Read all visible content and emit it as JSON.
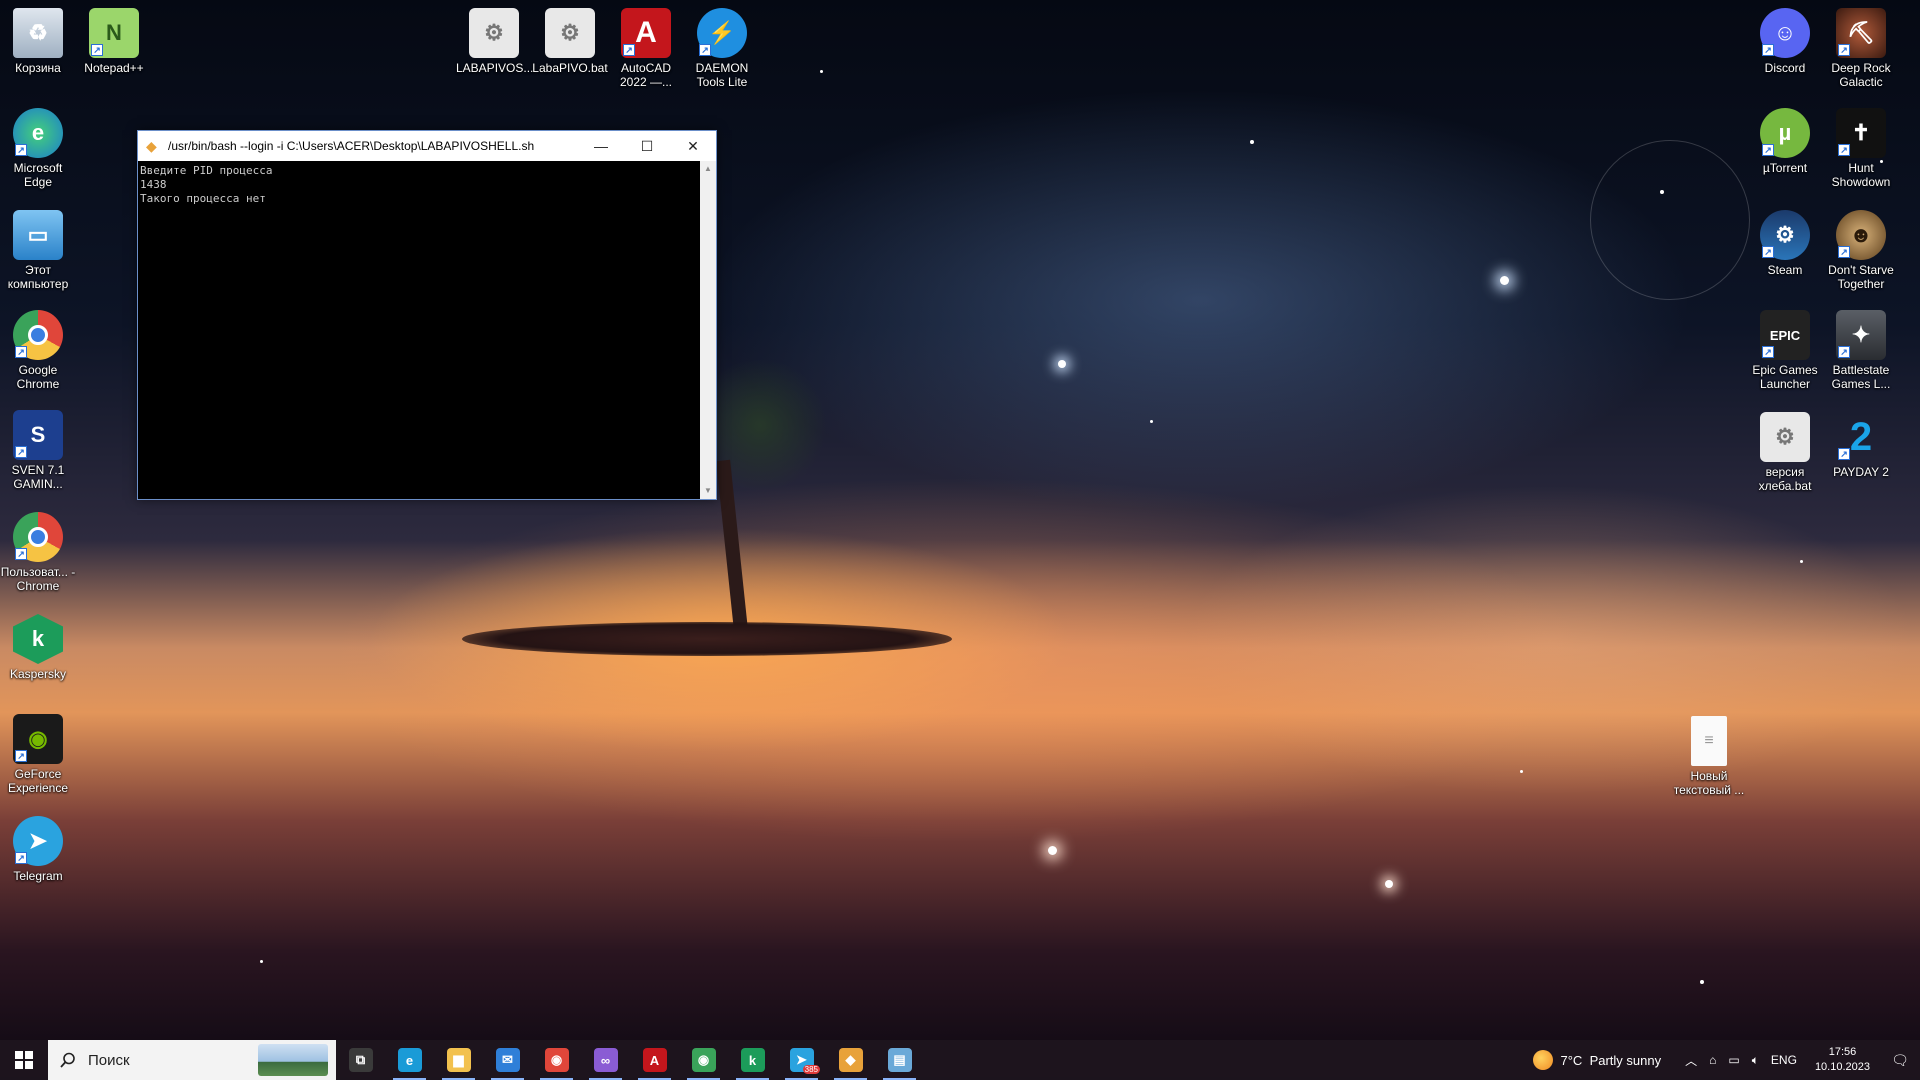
{
  "desktop": {
    "icons_left": [
      {
        "label": "Корзина",
        "icon": "recycle-bin-icon"
      },
      {
        "label": "Notepad++",
        "icon": "notepadpp-icon"
      },
      {
        "label": "Microsoft Edge",
        "icon": "edge-icon"
      },
      {
        "label": "Этот компьютер",
        "icon": "this-pc-icon"
      },
      {
        "label": "Google Chrome",
        "icon": "chrome-icon"
      },
      {
        "label": "SVEN 7.1 GAMIN...",
        "icon": "sven-icon"
      },
      {
        "label": "Пользоват... - Chrome",
        "icon": "chrome-user-icon"
      },
      {
        "label": "Kaspersky",
        "icon": "kaspersky-icon"
      },
      {
        "label": "GeForce Experience",
        "icon": "geforce-icon"
      },
      {
        "label": "Telegram",
        "icon": "telegram-icon"
      }
    ],
    "icons_top": [
      {
        "label": "LABAPIVOS...",
        "icon": "batch-file-icon"
      },
      {
        "label": "LabaPIVO.bat",
        "icon": "batch-file-icon"
      },
      {
        "label": "AutoCAD 2022 —...",
        "icon": "autocad-icon"
      },
      {
        "label": "DAEMON Tools Lite",
        "icon": "daemon-tools-icon"
      }
    ],
    "icons_right": [
      {
        "label": "Discord",
        "icon": "discord-icon"
      },
      {
        "label": "Deep Rock Galactic",
        "icon": "deep-rock-icon"
      },
      {
        "label": "µTorrent",
        "icon": "utorrent-icon"
      },
      {
        "label": "Hunt Showdown",
        "icon": "hunt-icon"
      },
      {
        "label": "Steam",
        "icon": "steam-icon"
      },
      {
        "label": "Don't Starve Together",
        "icon": "dont-starve-icon"
      },
      {
        "label": "Epic Games Launcher",
        "icon": "epic-games-icon"
      },
      {
        "label": "Battlestate Games L...",
        "icon": "battlestate-icon"
      },
      {
        "label": "версия хлеба.bat",
        "icon": "batch-file-icon"
      },
      {
        "label": "PAYDAY 2",
        "icon": "payday-icon"
      },
      {
        "label": "Новый текстовый ...",
        "icon": "text-file-icon"
      }
    ]
  },
  "terminal": {
    "title": "/usr/bin/bash --login -i C:\\Users\\ACER\\Desktop\\LABAPIVOSHELL.sh",
    "lines": [
      "Введите PID процесса",
      "1438",
      "Такого процесса нет"
    ],
    "minimize": "—",
    "maximize": "☐",
    "close": "✕"
  },
  "taskbar": {
    "search_placeholder": "Поиск",
    "apps": [
      {
        "name": "task-view",
        "glyph": "⧉",
        "color": "#3a3a3a"
      },
      {
        "name": "edge",
        "glyph": "e",
        "color": "#1a9bd7"
      },
      {
        "name": "file-explorer",
        "glyph": "▆",
        "color": "#f2c14e"
      },
      {
        "name": "mail",
        "glyph": "✉",
        "color": "#2f7fd8"
      },
      {
        "name": "chrome",
        "glyph": "◉",
        "color": "#e0463a"
      },
      {
        "name": "visual-studio",
        "glyph": "∞",
        "color": "#8a5cd4"
      },
      {
        "name": "autocad",
        "glyph": "A",
        "color": "#c4161c"
      },
      {
        "name": "chrome-profile",
        "glyph": "◉",
        "color": "#3aa35a"
      },
      {
        "name": "kaspersky",
        "glyph": "k",
        "color": "#1c9c5a"
      },
      {
        "name": "telegram",
        "glyph": "➤",
        "color": "#2aa3df",
        "badge": "385"
      },
      {
        "name": "git-bash",
        "glyph": "◆",
        "color": "#e8a23a"
      },
      {
        "name": "notepad",
        "glyph": "▤",
        "color": "#6aa9d8"
      }
    ],
    "weather_temp": "7°C",
    "weather_text": "Partly sunny",
    "language": "ENG",
    "time": "17:56",
    "date": "10.10.2023"
  }
}
